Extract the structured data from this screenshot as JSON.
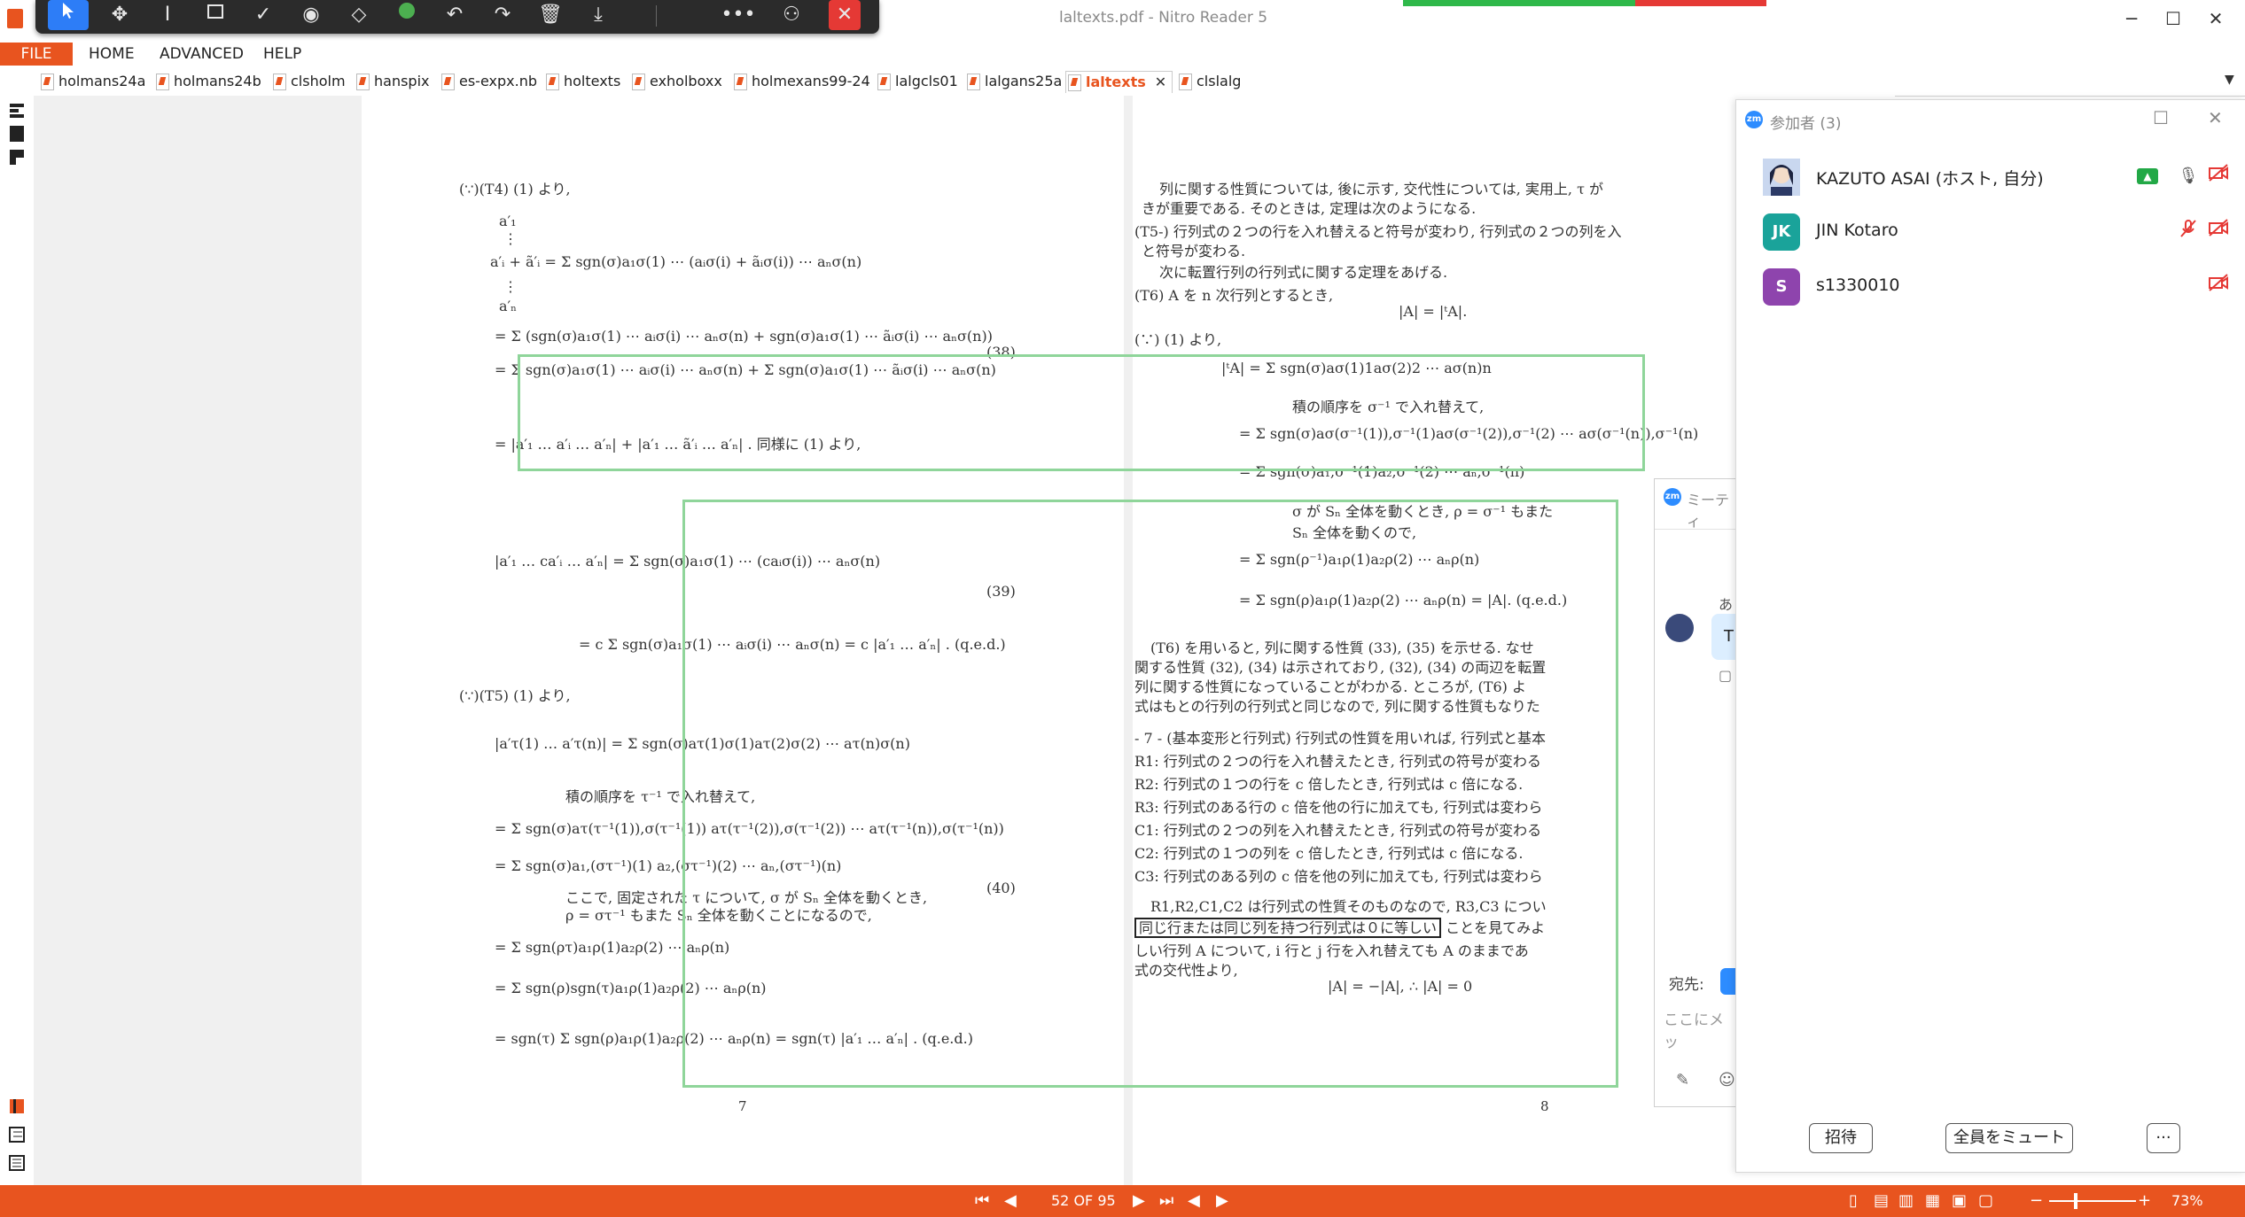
{
  "window": {
    "title": "laltexts.pdf - Nitro Reader 5",
    "minimize": "─",
    "maximize": "☐",
    "close": "✕"
  },
  "toolbar": {
    "icons": [
      "select-arrow-icon",
      "move-icon",
      "text-cursor-icon",
      "rectangle-icon",
      "check-icon",
      "stamp-icon",
      "eraser-icon",
      "green-dot-icon",
      "undo-icon",
      "redo-icon",
      "delete-icon",
      "download-icon",
      "more-icon",
      "share-icon",
      "close-icon"
    ]
  },
  "menu": {
    "file": "FILE",
    "home": "HOME",
    "advanced": "ADVANCED",
    "help": "HELP"
  },
  "tabs": [
    {
      "label": "holmans24a"
    },
    {
      "label": "holmans24b"
    },
    {
      "label": "clsholm"
    },
    {
      "label": "hanspix"
    },
    {
      "label": "es-expx.nb"
    },
    {
      "label": "holtexts"
    },
    {
      "label": "exholboxx"
    },
    {
      "label": "holmexans99-24"
    },
    {
      "label": "lalgcls01"
    },
    {
      "label": "lalgans25a"
    },
    {
      "label": "laltexts",
      "active": true
    },
    {
      "label": "clslalg"
    }
  ],
  "document": {
    "left_page": {
      "lines": [
        "(∵)(T4) (1) より,",
        "a′₁",
        "⋮",
        "a′ᵢ + ã′ᵢ  = Σ sgn(σ)a₁σ(1) ⋯ (aᵢσ(i) + ãᵢσ(i)) ⋯ aₙσ(n)",
        "⋮",
        "a′ₙ",
        "= Σ (sgn(σ)a₁σ(1) ⋯ aᵢσ(i) ⋯ aₙσ(n) + sgn(σ)a₁σ(1) ⋯ ãᵢσ(i) ⋯ aₙσ(n))",
        "= Σ sgn(σ)a₁σ(1) ⋯ aᵢσ(i) ⋯ aₙσ(n) + Σ sgn(σ)a₁σ(1) ⋯ ãᵢσ(i) ⋯ aₙσ(n)",
        "= |a′₁ … a′ᵢ … a′ₙ| + |a′₁ … ã′ᵢ … a′ₙ| .      同様に (1) より,",
        "|a′₁ … ca′ᵢ … a′ₙ| = Σ sgn(σ)a₁σ(1) ⋯ (caᵢσ(i)) ⋯ aₙσ(n)",
        "= c Σ sgn(σ)a₁σ(1) ⋯ aᵢσ(i) ⋯ aₙσ(n) = c |a′₁ … a′ₙ| .      (q.e.d.)",
        "(∵)(T5) (1) より,",
        "|a′τ(1) … a′τ(n)| = Σ sgn(σ)aτ(1)σ(1)aτ(2)σ(2) ⋯ aτ(n)σ(n)",
        "積の順序を τ⁻¹ で入れ替えて,",
        "= Σ sgn(σ)aτ(τ⁻¹(1)),σ(τ⁻¹(1)) aτ(τ⁻¹(2)),σ(τ⁻¹(2)) ⋯ aτ(τ⁻¹(n)),σ(τ⁻¹(n))",
        "= Σ sgn(σ)a₁,(στ⁻¹)(1) a₂,(στ⁻¹)(2) ⋯ aₙ,(στ⁻¹)(n)",
        "ここで, 固定された τ について, σ が Sₙ 全体を動くとき,",
        "ρ = στ⁻¹ もまた Sₙ 全体を動くことになるので,",
        "= Σ sgn(ρτ)a₁ρ(1)a₂ρ(2) ⋯ aₙρ(n)",
        "= Σ sgn(ρ)sgn(τ)a₁ρ(1)a₂ρ(2) ⋯ aₙρ(n)",
        "= sgn(τ) Σ sgn(ρ)a₁ρ(1)a₂ρ(2) ⋯ aₙρ(n) = sgn(τ) |a′₁ … a′ₙ| .      (q.e.d.)"
      ],
      "eq_numbers": [
        "(38)",
        "(39)",
        "(40)"
      ],
      "page_number": "7"
    },
    "right_page": {
      "lines": [
        "列に関する性質については, 後に示す, 交代性については, 実用上, τ が",
        "きが重要である. そのときは, 定理は次のようになる.",
        "(T5-) 行列式の２つの行を入れ替えると符号が変わり, 行列式の２つの列を入",
        "と符号が変わる.",
        "次に転置行列の行列式に関する定理をあげる.",
        "(T6) A を n 次行列とするとき,",
        "|A| = |ᵗA|.",
        "(∵) (1) より,",
        "|ᵗA| = Σ sgn(σ)aσ(1)1aσ(2)2 ⋯ aσ(n)n",
        "積の順序を σ⁻¹ で入れ替えて,",
        "= Σ sgn(σ)aσ(σ⁻¹(1)),σ⁻¹(1)aσ(σ⁻¹(2)),σ⁻¹(2) ⋯ aσ(σ⁻¹(n)),σ⁻¹(n)",
        "= Σ sgn(σ)a₁,σ⁻¹(1)a₂,σ⁻¹(2) ⋯ aₙ,σ⁻¹(n)",
        "σ が Sₙ 全体を動くとき, ρ = σ⁻¹ もまた",
        "Sₙ 全体を動くので,",
        "= Σ sgn(ρ⁻¹)a₁ρ(1)a₂ρ(2) ⋯ aₙρ(n)",
        "= Σ sgn(ρ)a₁ρ(1)a₂ρ(2) ⋯ aₙρ(n) = |A|.      (q.e.d.)",
        "(T6) を用いると, 列に関する性質 (33), (35) を示せる. なせ",
        "関する性質 (32), (34) は示されており, (32), (34) の両辺を転置",
        "列に関する性質になっていることがわかる. ところが, (T6) よ",
        "式はもとの行列の行列式と同じなので, 列に関する性質もなりた",
        "- 7 - (基本変形と行列式) 行列式の性質を用いれば, 行列式と基本",
        "R1: 行列式の２つの行を入れ替えたとき, 行列式の符号が変わる",
        "R2: 行列式の１つの行を c 倍したとき, 行列式は c 倍になる.",
        "R3: 行列式のある行の c 倍を他の行に加えても, 行列式は変わら",
        "C1: 行列式の２つの列を入れ替えたとき, 行列式の符号が変わる",
        "C2: 行列式の１つの列を c 倍したとき, 行列式は c 倍になる.",
        "C3: 行列式のある列の c 倍を他の列に加えても, 行列式は変わら",
        "R1,R2,C1,C2 は行列式の性質そのものなので, R3,C3 につい",
        "しい行列 A について, i 行と j 行を入れ替えても A のままであ",
        "式の交代性より,",
        "|A| = −|A|,      ∴  |A| = 0"
      ],
      "boxed_phrase": "同じ行または同じ列を持つ行列式は０に等しい",
      "boxed_suffix": "ことを見てみよ",
      "page_number": "8"
    }
  },
  "zoom": {
    "panel_title": "参加者 (3)",
    "participants": [
      {
        "name": "KAZUTO ASAI (ホスト, 自分)",
        "initials": "",
        "color": "#3a4a7a"
      },
      {
        "name": "JIN Kotaro",
        "initials": "JK",
        "color": "#1aa39a"
      },
      {
        "name": "s1330010",
        "initials": "S",
        "color": "#8e44ad"
      }
    ],
    "invite": "招待",
    "mute_all": "全員をミュート",
    "more": "···",
    "chat": {
      "title": "ミーティ",
      "sender_fragment": "あ",
      "message_fragment": "T",
      "to_label": "宛先:",
      "input_placeholder": "ここにメッ"
    }
  },
  "status": {
    "page_indicator": "52 OF 95",
    "zoom_level": "73%"
  }
}
